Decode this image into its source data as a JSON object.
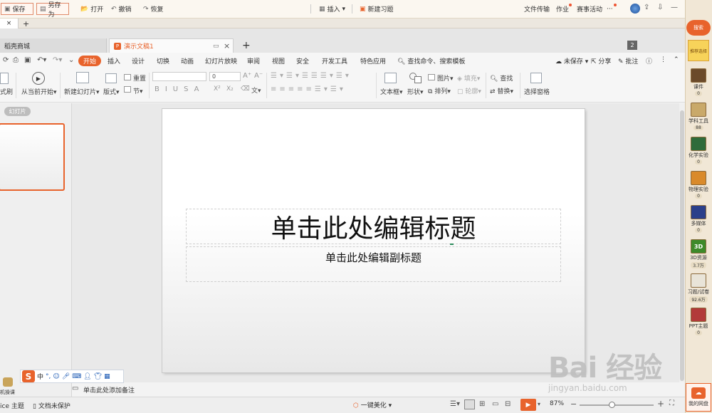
{
  "topbar": {
    "save": "保存",
    "save_as": "另存为",
    "open": "打开",
    "undo": "撤销",
    "redo": "恢复",
    "insert": "插入",
    "new_question": "新建习题",
    "file_transfer": "文件传输",
    "homework": "作业",
    "events": "赛事活动",
    "more": "···"
  },
  "doc_tabs": {
    "store": "稻壳商城",
    "doc": "演示文稿1",
    "count": "2"
  },
  "menu": {
    "items": [
      "开始",
      "插入",
      "设计",
      "切换",
      "动画",
      "幻灯片放映",
      "审阅",
      "视图",
      "安全",
      "开发工具",
      "特色应用"
    ],
    "search": "查找命令、搜索模板",
    "unsaved": "未保存",
    "share": "分享",
    "comment": "批注"
  },
  "ribbon": {
    "format_brush": "式刷",
    "from_current": "从当前开始",
    "new_slide": "新建幻灯片",
    "layout": "版式",
    "reset": "重置",
    "section": "节",
    "font_size": "0",
    "text_box": "文本框",
    "shape": "形状",
    "picture": "图片",
    "fill": "填充",
    "arrange": "排列",
    "outline": "轮廓",
    "find": "查找",
    "replace": "替换",
    "select_pane": "选择窗格",
    "wen": "文"
  },
  "slides_panel": {
    "tab": "幻灯片"
  },
  "slide": {
    "title": "单击此处编辑标题",
    "subtitle": "单击此处编辑副标题"
  },
  "notes": {
    "placeholder": "单击此处添加备注"
  },
  "status": {
    "theme": "ice 主题",
    "protect": "文档未保护",
    "beautify": "一键美化",
    "zoom": "87%"
  },
  "ime": {
    "logo": "S",
    "mode": "中"
  },
  "left_widget": {
    "label": "机操课"
  },
  "right_sidebar": {
    "search": "搜索",
    "items": [
      {
        "label": "课件",
        "count": "0",
        "color": "#6b4a2a"
      },
      {
        "label": "学科工具",
        "count": "88",
        "color": "#c9a96a"
      },
      {
        "label": "化学实验",
        "count": "0",
        "color": "#2f6b3a"
      },
      {
        "label": "物理实验",
        "count": "0",
        "color": "#d98a2b"
      },
      {
        "label": "多媒体",
        "count": "0",
        "color": "#2b3f8a"
      },
      {
        "label": "3D资源",
        "count": "3.7万",
        "color": "#3d8a2a"
      },
      {
        "label": "习题/试卷",
        "count": "92.6万",
        "color": "#e9e4d8"
      },
      {
        "label": "PPT主题",
        "count": "0",
        "color": "#b23a3a"
      }
    ],
    "top_item": "推荐选择",
    "bottom": "我的网盘"
  },
  "watermark": {
    "big": "Bai 经验",
    "small": "jingyan.baidu.com"
  }
}
